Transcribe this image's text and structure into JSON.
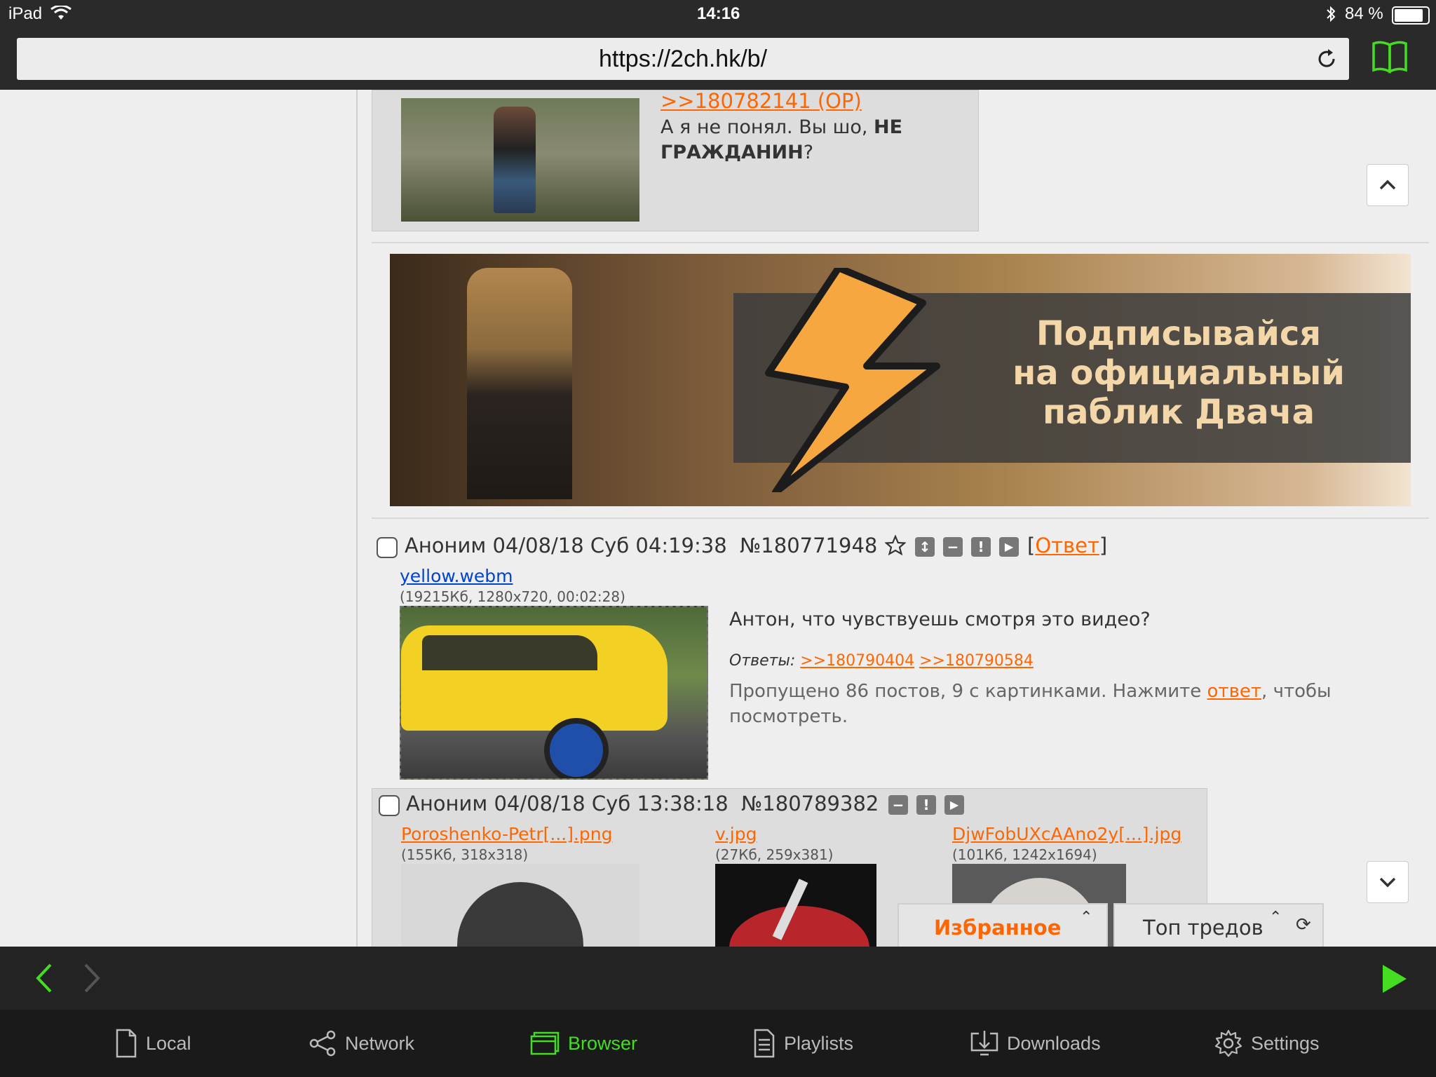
{
  "status": {
    "device": "iPad",
    "time": "14:16",
    "battery": "84 %"
  },
  "browser": {
    "url": "https://2ch.hk/b/"
  },
  "post_top": {
    "reply_link": ">>180782141 (OP)",
    "text_a": "А я не понял. Вы шо, ",
    "text_bold": "НЕ ГРАЖДАНИН",
    "text_end": "?"
  },
  "banner": {
    "line1": "Подписывайся",
    "line2": "на официальный",
    "line3": "паблик Двача"
  },
  "post1": {
    "author": "Аноним",
    "date": "04/08/18 Суб 04:19:38",
    "number": "№180771948",
    "reply_bracket_open": "[",
    "reply_label": "Ответ",
    "reply_bracket_close": "]",
    "file_name": "yellow.webm",
    "file_meta": "(19215Кб, 1280x720, 00:02:28)",
    "text": "Антон, что чувствуешь смотря это видео?",
    "replies_label": "Ответы:",
    "replies": [
      ">>180790404",
      ">>180790584"
    ],
    "skipped_a": "Пропущено 86 постов, 9 с картинками. Нажмите ",
    "skipped_link": "ответ",
    "skipped_b": ", чтобы посмотреть."
  },
  "post2": {
    "author": "Аноним",
    "date": "04/08/18 Суб 13:38:18",
    "number": "№180789382",
    "files": [
      {
        "name": "Poroshenko-Petr[...].png",
        "meta": "(155Кб, 318x318)"
      },
      {
        "name": "v.jpg",
        "meta": "(27Кб, 259x381)"
      },
      {
        "name": "DjwFobUXcAAno2y[...].jpg",
        "meta": "(101Кб, 1242x1694)"
      }
    ]
  },
  "floating_tabs": {
    "favorites": "Избранное",
    "top_threads": "Топ тредов"
  },
  "tabbar": [
    {
      "label": "Local",
      "icon": "document-icon"
    },
    {
      "label": "Network",
      "icon": "share-icon"
    },
    {
      "label": "Browser",
      "icon": "browser-icon"
    },
    {
      "label": "Playlists",
      "icon": "playlist-icon"
    },
    {
      "label": "Downloads",
      "icon": "download-icon"
    },
    {
      "label": "Settings",
      "icon": "gear-icon"
    }
  ],
  "colors": {
    "accent_green": "#44dd22",
    "link_orange": "#ff6600",
    "link_blue": "#0044cc"
  }
}
